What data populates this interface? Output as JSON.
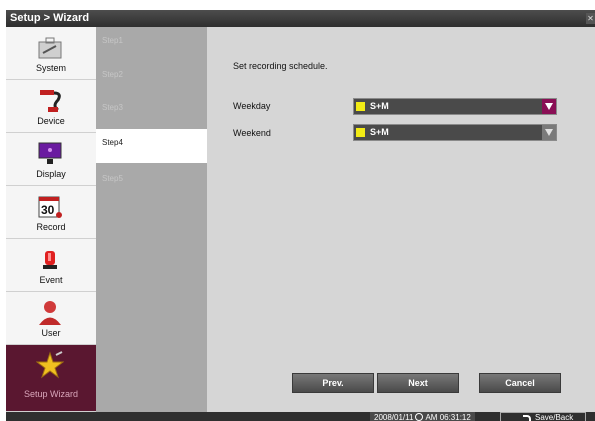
{
  "window": {
    "title": "Setup > Wizard",
    "close_icon": "close-icon"
  },
  "sidebar": {
    "items": [
      {
        "label": "System",
        "icon": "toolbox-icon"
      },
      {
        "label": "Device",
        "icon": "cable-icon"
      },
      {
        "label": "Display",
        "icon": "monitor-icon"
      },
      {
        "label": "Record",
        "icon": "calendar-record-icon"
      },
      {
        "label": "Event",
        "icon": "siren-icon"
      },
      {
        "label": "User",
        "icon": "user-icon"
      },
      {
        "label": "Setup Wizard",
        "icon": "wizard-star-icon",
        "active": true
      }
    ]
  },
  "steps": [
    {
      "label": "Step1"
    },
    {
      "label": "Step2"
    },
    {
      "label": "Step3"
    },
    {
      "label": "Step4",
      "active": true
    },
    {
      "label": "Step5"
    }
  ],
  "main": {
    "instruction": "Set recording schedule.",
    "weekday": {
      "label": "Weekday",
      "value": "S+M",
      "swatch_color": "#f2eb15"
    },
    "weekend": {
      "label": "Weekend",
      "value": "S+M",
      "swatch_color": "#f2eb15"
    }
  },
  "buttons": {
    "prev": "Prev.",
    "next": "Next",
    "cancel": "Cancel"
  },
  "status": {
    "date": "2008/01/11",
    "ampm": "AM",
    "time": "06:31:12",
    "save_back": "Save/Back"
  },
  "colors": {
    "accent": "#8a0f55",
    "sidebar_active": "#5a1730",
    "title_bar": "#3a3a3a"
  }
}
